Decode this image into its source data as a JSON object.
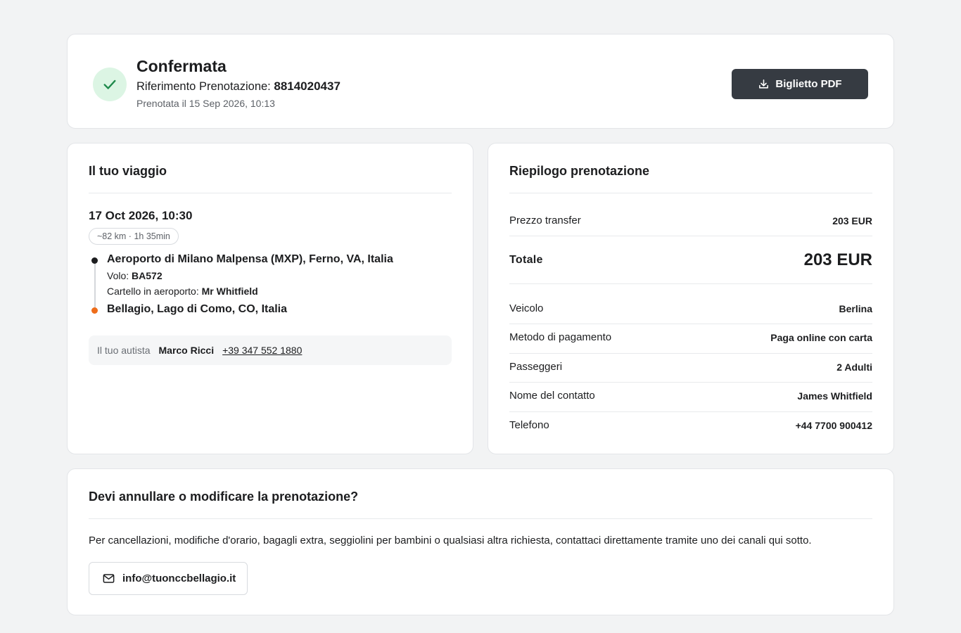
{
  "header": {
    "status": "Confermata",
    "reference_label": "Riferimento Prenotazione:",
    "reference_value": "8814020437",
    "booked_at": "Prenotata il 15 Sep 2026, 10:13",
    "pdf_button_label": "Biglietto PDF",
    "status_icon": "check-icon",
    "accent_color": "#1f8a4c"
  },
  "trip": {
    "title": "Il tuo viaggio",
    "date_time": "17 Oct 2026, 10:30",
    "distance_duration": "~82 km · 1h 35min",
    "pickup": "Aeroporto di Milano Malpensa (MXP), Ferno, VA, Italia",
    "flight_label": "Volo:",
    "flight_value": "BA572",
    "sign_label": "Cartello in aeroporto:",
    "sign_value": "Mr Whitfield",
    "dropoff": "Bellagio, Lago di Como, CO, Italia",
    "driver_label": "Il tuo autista",
    "driver_name": "Marco Ricci",
    "driver_phone": "+39 347 552 1880",
    "dropoff_color": "#ee6d1b"
  },
  "summary": {
    "title": "Riepilogo prenotazione",
    "transfer_price_label": "Prezzo transfer",
    "transfer_price_value": "203 EUR",
    "total_label": "Totale",
    "total_value": "203 EUR",
    "rows": [
      {
        "label": "Veicolo",
        "value": "Berlina"
      },
      {
        "label": "Metodo di pagamento",
        "value": "Paga online con carta"
      },
      {
        "label": "Passeggeri",
        "value": "2 Adulti"
      },
      {
        "label": "Nome del contatto",
        "value": "James Whitfield"
      },
      {
        "label": "Telefono",
        "value": "+44 7700 900412"
      }
    ]
  },
  "cancel": {
    "title": "Devi annullare o modificare la prenotazione?",
    "text": "Per cancellazioni, modifiche d'orario, bagagli extra, seggiolini per bambini o qualsiasi altra richiesta, contattaci direttamente tramite uno dei canali qui sotto.",
    "email": "info@tuonccbellagio.it",
    "email_icon": "mail-icon"
  }
}
